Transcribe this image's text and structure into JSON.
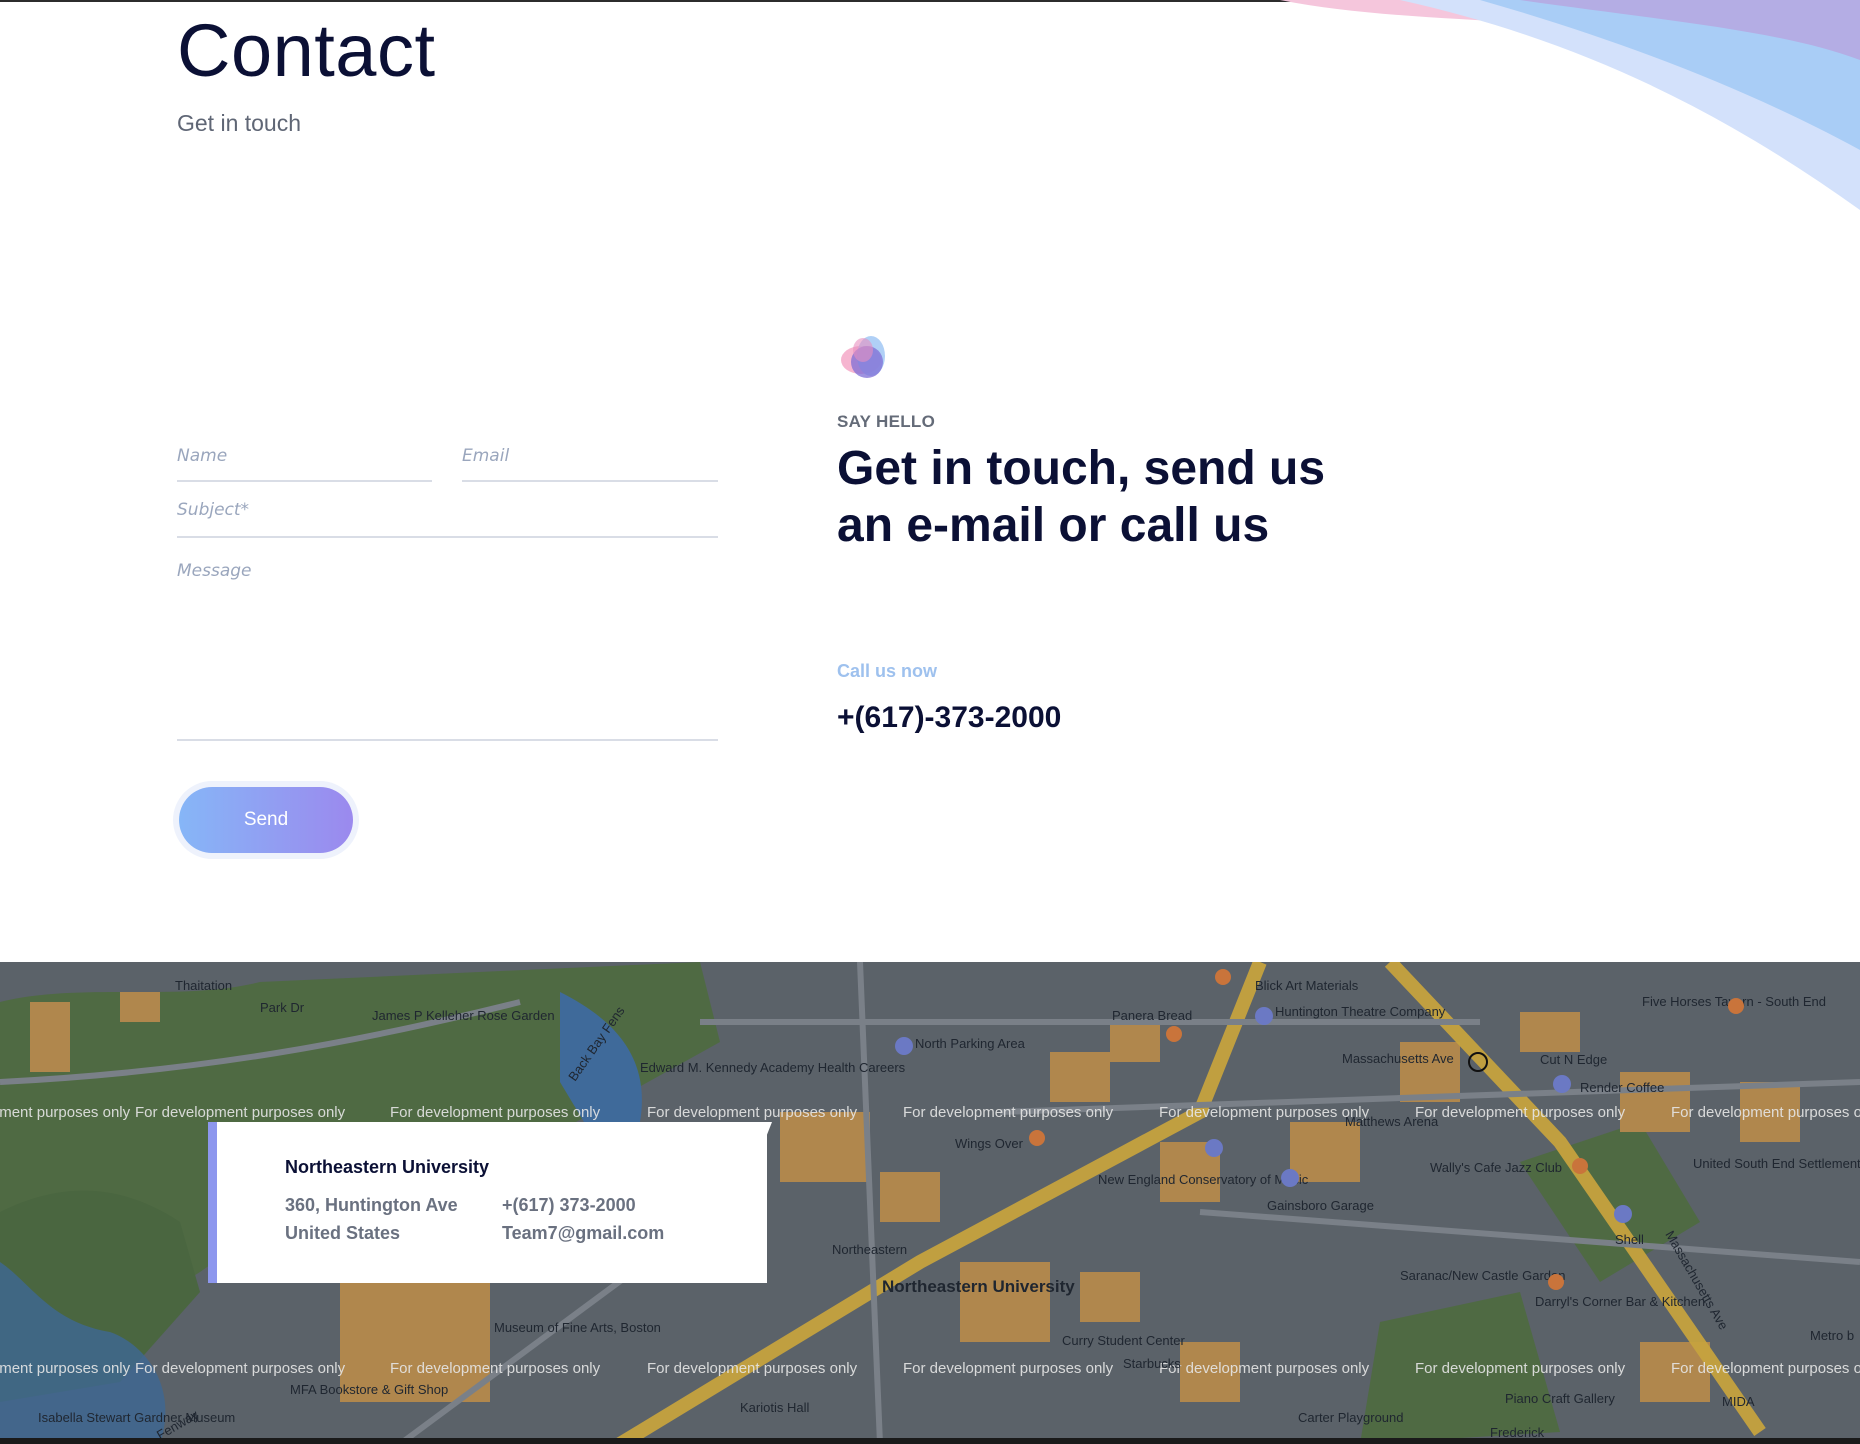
{
  "header": {
    "title": "Contact",
    "subtitle": "Get in touch"
  },
  "form": {
    "name_placeholder": "Name",
    "email_placeholder": "Email",
    "subject_placeholder": "Subject*",
    "message_placeholder": "Message",
    "send_label": "Send"
  },
  "hello": {
    "eyebrow": "SAY HELLO",
    "headline": "Get in touch, send us an e-mail or call us",
    "call_label": "Call us now",
    "phone": "+(617)-373-2000"
  },
  "map": {
    "watermark": "For development purposes only",
    "labels": [
      "Thaitation",
      "Park Dr",
      "James P Kelleher Rose Garden",
      "Back Bay Fens",
      "Edward M. Kennedy Academy Health Careers",
      "North Parking Area",
      "Panera Bread",
      "Huntington Theatre Company",
      "Blick Art Materials",
      "Massachusetts Ave",
      "Cut N Edge",
      "Render Coffee",
      "Five Horses Tavern - South End",
      "Matthews Arena",
      "Wings Over",
      "New England Conservatory of Music",
      "Gainsboro Garage",
      "Wally's Cafe Jazz Club",
      "United South End Settlements (Harriet...",
      "Shell",
      "Northeastern",
      "Northeastern University",
      "Saranac/New Castle Garden",
      "Darryl's Corner Bar & Kitchen",
      "Museum of Fine Arts, Boston",
      "MFA Bookstore & Gift Shop",
      "Curry Student Center",
      "Starbucks",
      "Kariotis Hall",
      "Piano Craft Gallery",
      "Isabella Stewart Gardner Museum",
      "Carter Playground",
      "Frederick",
      "MIDA",
      "Metro b",
      "Fenway",
      "Massachusetts Ave"
    ]
  },
  "card": {
    "name": "Northeastern University",
    "address_line1": "360, Huntington Ave",
    "address_line2": "United States",
    "phone": "+(617) 373-2000",
    "email": "Team7@gmail.com"
  },
  "colors": {
    "navy": "#0b1035",
    "gradient_start": "#86b6f7",
    "gradient_end": "#9b89ee",
    "accent_blue": "#9ec1ee"
  }
}
